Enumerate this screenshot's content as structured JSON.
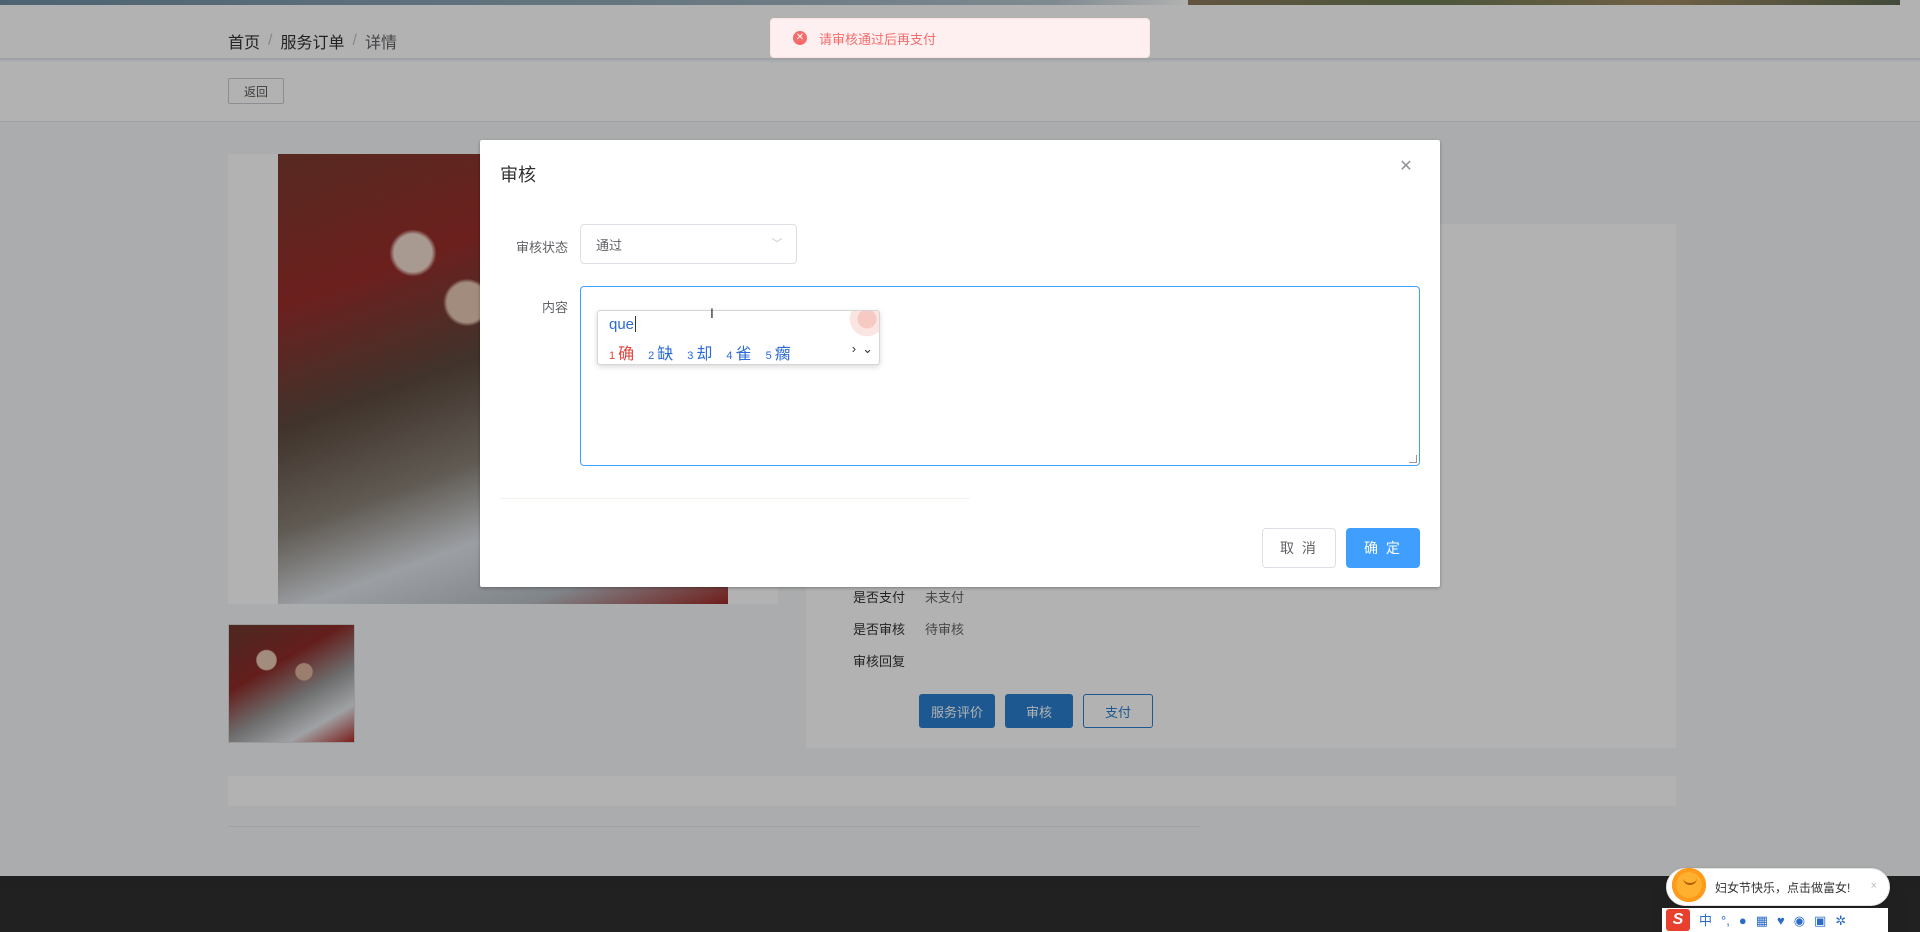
{
  "breadcrumb": {
    "home": "首页",
    "section": "服务订单",
    "current": "详情",
    "separator": "/"
  },
  "toolbar": {
    "back_label": "返回"
  },
  "order_info": {
    "pay_label": "是否支付",
    "pay_value": "未支付",
    "audit_label": "是否审核",
    "audit_value": "待审核",
    "reply_label": "审核回复"
  },
  "actions": {
    "evaluate_label": "服务评价",
    "audit_label": "审核",
    "pay_label": "支付"
  },
  "toast": {
    "message": "请审核通过后再支付"
  },
  "dialog": {
    "title": "审核",
    "status_label": "审核状态",
    "status_value": "通过",
    "content_label": "内容",
    "cancel_label": "取 消",
    "confirm_label": "确 定"
  },
  "ime": {
    "pinyin": "que",
    "candidates": [
      {
        "num": "1",
        "char": "确"
      },
      {
        "num": "2",
        "char": "缺"
      },
      {
        "num": "3",
        "char": "却"
      },
      {
        "num": "4",
        "char": "雀"
      },
      {
        "num": "5",
        "char": "瘸"
      }
    ],
    "next_glyph": "›",
    "expand_glyph": "⌄"
  },
  "sogou": {
    "festival_text": "妇女节快乐，点击做富女!",
    "close_glyph": "×",
    "logo": "S",
    "mode": "中",
    "punct": "°,",
    "tools": [
      "mic-icon",
      "keyboard-icon",
      "skin-icon",
      "game-icon",
      "grid-icon",
      "settings-icon"
    ]
  },
  "colors": {
    "primary": "#409eff",
    "error": "#f56c6c",
    "action_blue": "#2b7fd0",
    "footer": "#2f2f2f"
  }
}
